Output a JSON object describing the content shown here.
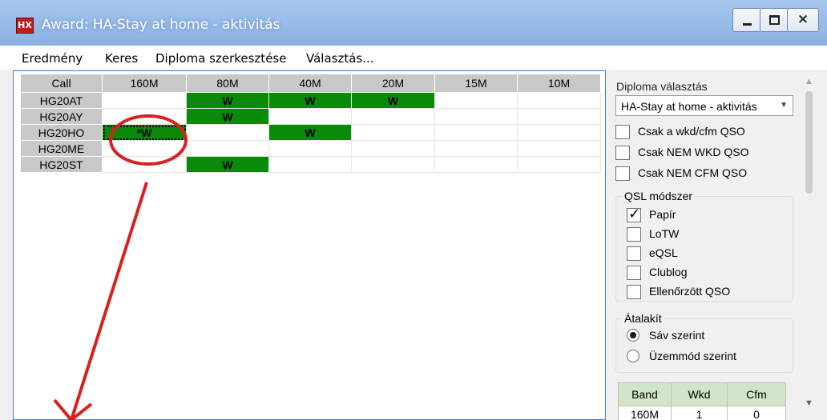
{
  "window": {
    "title": "Award: HA-Stay at home - aktivitás",
    "icon_text": "HX",
    "controls": {
      "minimize": "minimize-icon",
      "maximize": "maximize-icon",
      "close": "×"
    }
  },
  "menu": [
    "Eredmény",
    "Keres",
    "Diploma szerkesztése",
    "Választás..."
  ],
  "grid": {
    "columns": [
      "Call",
      "160M",
      "80M",
      "40M",
      "20M",
      "15M",
      "10M"
    ],
    "rows": [
      {
        "call": "HG20AT",
        "cells": [
          "",
          "W",
          "W",
          "W",
          "",
          ""
        ]
      },
      {
        "call": "HG20AY",
        "cells": [
          "",
          "W",
          "",
          "",
          "",
          ""
        ]
      },
      {
        "call": "HG20HO",
        "cells": [
          "*W",
          "",
          "W",
          "",
          "",
          ""
        ]
      },
      {
        "call": "HG20ME",
        "cells": [
          "",
          "",
          "",
          "",
          "",
          ""
        ]
      },
      {
        "call": "HG20ST",
        "cells": [
          "",
          "W",
          "",
          "",
          "",
          ""
        ]
      }
    ],
    "fill_color": "#0a8a0a"
  },
  "side": {
    "diploma_label": "Diploma választás",
    "diploma_value": "HA-Stay at home - aktivitás",
    "filters": [
      {
        "label": "Csak a wkd/cfm QSO",
        "checked": false
      },
      {
        "label": "Csak NEM WKD QSO",
        "checked": false
      },
      {
        "label": "Csak NEM CFM QSO",
        "checked": false
      }
    ],
    "qsl": {
      "title": "QSL módszer",
      "options": [
        {
          "label": "Papír",
          "checked": true
        },
        {
          "label": "LoTW",
          "checked": false
        },
        {
          "label": "eQSL",
          "checked": false
        },
        {
          "label": "Clublog",
          "checked": false
        },
        {
          "label": "Ellenőrzött QSO",
          "checked": false
        }
      ]
    },
    "convert": {
      "title": "Átalakít",
      "options": [
        {
          "label": "Sáv szerint",
          "selected": true
        },
        {
          "label": "Üzemmód szerint",
          "selected": false
        }
      ]
    },
    "summary": {
      "headers": [
        "Band",
        "Wkd",
        "Cfm"
      ],
      "rows": [
        [
          "160M",
          "1",
          "0"
        ]
      ]
    }
  },
  "annotation_color": "#d92020"
}
